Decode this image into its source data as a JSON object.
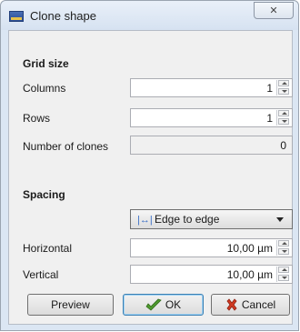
{
  "window": {
    "title": "Clone shape",
    "close_glyph": "✕"
  },
  "grid": {
    "heading": "Grid size",
    "columns": {
      "label": "Columns",
      "value": "1"
    },
    "rows": {
      "label": "Rows",
      "value": "1"
    },
    "clones": {
      "label": "Number of clones",
      "value": "0"
    }
  },
  "spacing": {
    "heading": "Spacing",
    "mode": "Edge to edge",
    "mode_icon": "|↔|",
    "horizontal": {
      "label": "Horizontal",
      "value": "10,00 µm"
    },
    "vertical": {
      "label": "Vertical",
      "value": "10,00 µm"
    }
  },
  "buttons": {
    "preview": "Preview",
    "ok": "OK",
    "cancel": "Cancel"
  },
  "icons": {
    "app": "app-icon",
    "ok": "check-arrow-icon",
    "cancel": "x-mark-icon"
  }
}
